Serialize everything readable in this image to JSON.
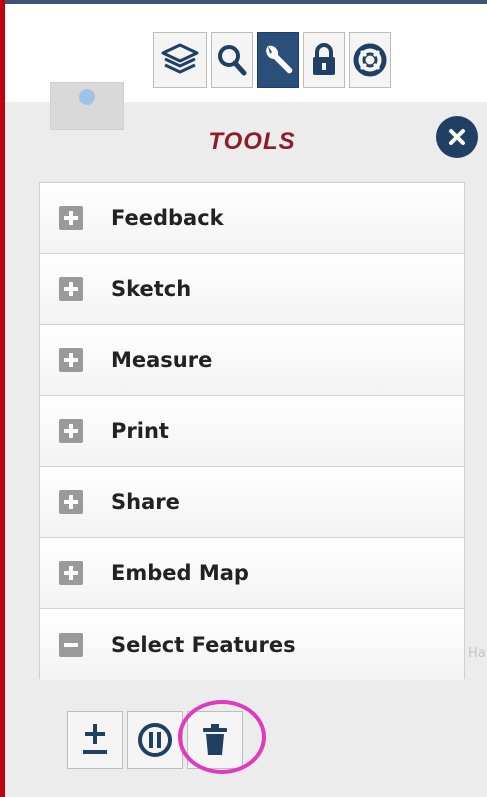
{
  "toolbar": {
    "items": [
      {
        "icon": "layers-icon",
        "label": "Layers"
      },
      {
        "icon": "search-icon",
        "label": "Search"
      },
      {
        "icon": "wrench-icon",
        "label": "Tools",
        "active": true
      },
      {
        "icon": "lock-icon",
        "label": "Lock"
      },
      {
        "icon": "lifebuoy-icon",
        "label": "Help"
      }
    ]
  },
  "panel": {
    "title": "TOOLS",
    "title_color": "#8e1c2c",
    "close_icon": "close-icon"
  },
  "tools": [
    {
      "label": "Feedback",
      "state": "collapsed"
    },
    {
      "label": "Sketch",
      "state": "collapsed"
    },
    {
      "label": "Measure",
      "state": "collapsed"
    },
    {
      "label": "Print",
      "state": "collapsed"
    },
    {
      "label": "Share",
      "state": "collapsed"
    },
    {
      "label": "Embed Map",
      "state": "collapsed"
    },
    {
      "label": "Select Features",
      "state": "expanded"
    }
  ],
  "select_tools": [
    {
      "icon": "plus-minus-icon"
    },
    {
      "icon": "pause-icon"
    },
    {
      "icon": "trash-icon",
      "highlighted": true
    }
  ],
  "background_text": "Ha",
  "colors": {
    "accent": "#2a4f7a",
    "border_red": "#c00010",
    "highlight": "#e03ac0"
  }
}
